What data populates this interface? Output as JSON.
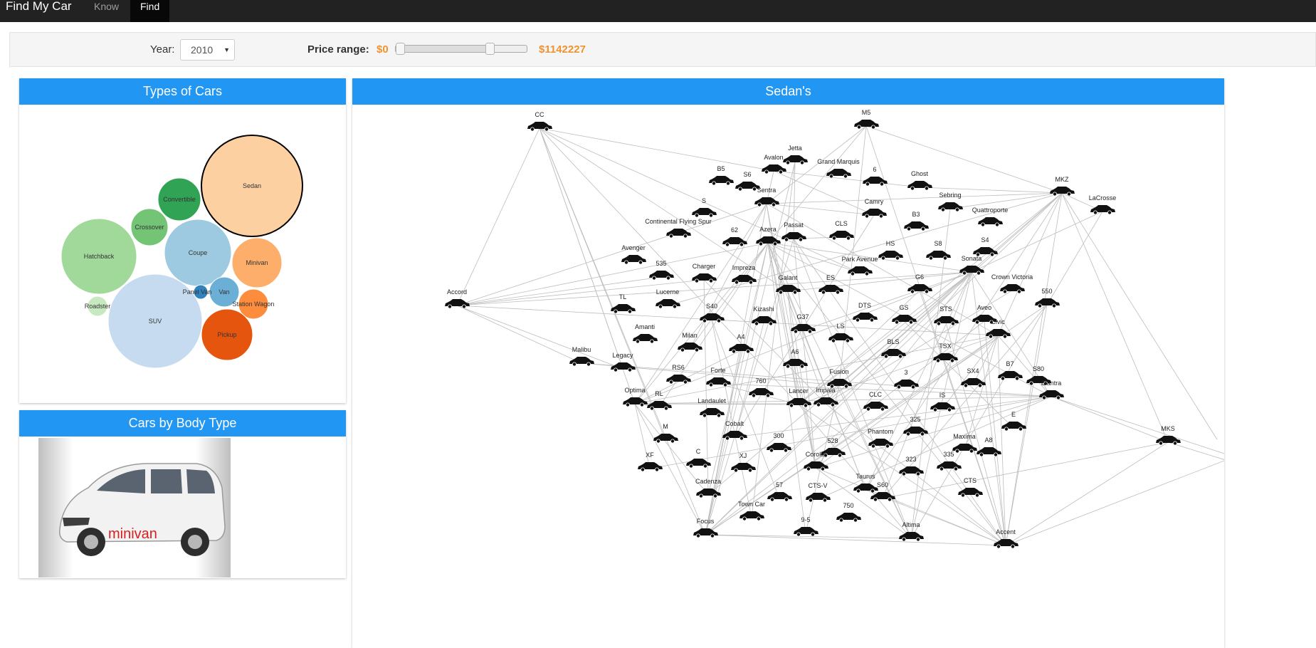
{
  "app": {
    "brand": "Find My Car",
    "tabs": [
      {
        "label": "Know",
        "active": false
      },
      {
        "label": "Find",
        "active": true
      }
    ]
  },
  "filters": {
    "year_label": "Year:",
    "year_value": "2010",
    "price_label": "Price range:",
    "price_min": "$0",
    "price_max": "$1142227",
    "slider_min_fraction": 0.0,
    "slider_max_fraction": 0.73
  },
  "types_panel": {
    "title": "Types of Cars",
    "selected": "Sedan",
    "bubbles": [
      {
        "label": "Sedan",
        "color": "#fdd0a2",
        "selected": true
      },
      {
        "label": "Convertible",
        "color": "#31a354",
        "selected": false
      },
      {
        "label": "Crossover",
        "color": "#74c476",
        "selected": false
      },
      {
        "label": "Hatchback",
        "color": "#a1d99b",
        "selected": false
      },
      {
        "label": "Coupe",
        "color": "#9ecae1",
        "selected": false
      },
      {
        "label": "Minivan",
        "color": "#fdae6b",
        "selected": false
      },
      {
        "label": "Roadster",
        "color": "#c7e9c0",
        "selected": false
      },
      {
        "label": "Panel Van",
        "color": "#3182bd",
        "selected": false
      },
      {
        "label": "Van",
        "color": "#6baed6",
        "selected": false
      },
      {
        "label": "Station Wagon",
        "color": "#fd8d3c",
        "selected": false
      },
      {
        "label": "SUV",
        "color": "#c6dbef",
        "selected": false
      },
      {
        "label": "Pickup",
        "color": "#e6550d",
        "selected": false
      }
    ]
  },
  "bodytype_panel": {
    "title": "Cars by Body Type",
    "image_caption": "minivan"
  },
  "sedans_panel": {
    "title": "Sedan's",
    "car_icon": "car-icon",
    "nodes": [
      "CC",
      "M5",
      "Jetta",
      "Avalon",
      "B5",
      "S6",
      "Sentra",
      "Grand Marquis",
      "6",
      "Ghost",
      "MKZ",
      "LaCrosse",
      "Camry",
      "Sebring",
      "Quattroporte",
      "S",
      "Continental Flying Spur",
      "62",
      "Azera",
      "Passat",
      "CLS",
      "B3",
      "S4",
      "Avenger",
      "HS",
      "S8",
      "Sonata",
      "535",
      "Charger",
      "Impreza",
      "Park Avenue",
      "Galant",
      "ES",
      "G6",
      "Crown Victoria",
      "Accord",
      "TL",
      "Lucerne",
      "S40",
      "Kizashi",
      "G37",
      "DTS",
      "GS",
      "STS",
      "Aveo",
      "550",
      "Civic",
      "Amanti",
      "Milan",
      "A4",
      "LS",
      "BLS",
      "TSX",
      "Malibu",
      "Legacy",
      "A6",
      "RS6",
      "Forte",
      "Fusion",
      "3",
      "SX4",
      "B7",
      "S80",
      "Elantra",
      "760",
      "Optima",
      "RL",
      "Lancer",
      "Impala",
      "CLC",
      "IS",
      "Landaulet",
      "E",
      "Cobalt",
      "325",
      "M",
      "Phantom",
      "MKS",
      "300",
      "Maxima",
      "A8",
      "528",
      "XF",
      "C",
      "XJ",
      "Corolla",
      "335",
      "323",
      "Taurus",
      "CTS",
      "Cadenza",
      "57",
      "CTS-V",
      "S60",
      "Town Car",
      "750",
      "Focus",
      "9-5",
      "Altima",
      "Accent"
    ]
  }
}
